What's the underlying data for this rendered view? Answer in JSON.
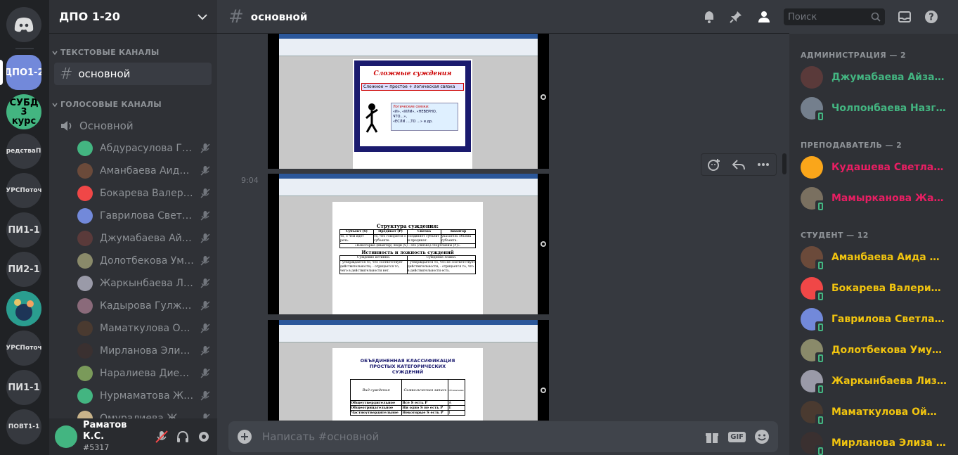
{
  "servers": [
    "ДПО1-2",
    "СУБД 3 курс",
    "СредстваПП",
    "УРСПоточ",
    "ПИ1-1",
    "ПИ2-1",
    "",
    "УРСПоточ",
    "ПИ1-1",
    "ПОВТ1-1"
  ],
  "guild": {
    "name": "ДПО 1-20"
  },
  "categories": {
    "text": "ТЕКСТОВЫЕ КАНАЛЫ",
    "voice": "ГОЛОСОВЫЕ КАНАЛЫ"
  },
  "text_channels": [
    {
      "name": "основной"
    }
  ],
  "voice_channel": {
    "name": "Основной"
  },
  "voice_users": [
    {
      "name": "Абдурасулова Гул...",
      "color": "#43b581"
    },
    {
      "name": "Аманбаева Аида ...",
      "color": "#6b4a3a"
    },
    {
      "name": "Бокарева Валерия ...",
      "color": "#f04747"
    },
    {
      "name": "Гаврилова Светла...",
      "color": "#7289da"
    },
    {
      "name": "Джумабаева Айза...",
      "color": "#5a3a3a"
    },
    {
      "name": "Долотбекова Умут...",
      "color": "#8a8a6a"
    },
    {
      "name": "Жаркынбаева Лиз...",
      "color": "#9a9aa8"
    },
    {
      "name": "Кадырова Гулжана...",
      "color": "#8a6a7a"
    },
    {
      "name": "Маматкулова Ой...",
      "color": "#4a3a30"
    },
    {
      "name": "Мирланова Элиза ...",
      "color": "#3a3030"
    },
    {
      "name": "Наралиева Диеза ...",
      "color": "#7a9a5a"
    },
    {
      "name": "Нурмаматова Жы...",
      "color": "#43b581"
    },
    {
      "name": "Омуралиева Жыл...",
      "color": "#c9b38a"
    }
  ],
  "user": {
    "name": "Раматов К.С.",
    "tag": "#5317"
  },
  "chat": {
    "channel": "основной",
    "search_placeholder": "Поиск",
    "composer_placeholder": "Написать #основной",
    "gif_label": "GIF",
    "timestamp": "9:04"
  },
  "slides": [
    {
      "title": "Сложные суждения",
      "formula": "Сложное = простое + логическая связка",
      "box_title": "Логические связки:",
      "box_lines": [
        "«И», «ИЛИ», «НЕВЕРНО,",
        "ЧТО…»,",
        "«ЕСЛИ …,ТО …» и др."
      ]
    },
    {
      "title": "Структура суждения:",
      "cols": [
        "Субъект (S)",
        "Предикат (P)",
        "Связка",
        "Квантор"
      ],
      "row": [
        "то, о чём идёт речь.",
        "то, что говорится о субъекте.",
        "соединяет субъект и предикат.",
        "указатель объёма субъекта."
      ],
      "example": "«Некоторые (квантор) люди (S) - это (связка) спортсмены (P)».",
      "title2": "Истинность и ложность суждений",
      "cols2": [
        "Суждение истинно:",
        "Суждение ложно:"
      ],
      "cells2": [
        "- утверждается то, что соответствует действительности; - отрицается то, чего в действительности нет.",
        "- утверждается то, что не соответствует действительности; - отрицается то, что в действительности есть."
      ]
    },
    {
      "title": "ОБЪЕДИНЕННАЯ КЛАССИФИКАЦИЯ ПРОСТЫХ КАТЕГОРИЧЕСКИХ СУЖДЕНИЙ",
      "cols": [
        "Вид суждения",
        "Символическая запись",
        "Обозначение"
      ],
      "rows": [
        [
          "Общеутвердительное",
          "Все S есть P",
          "A"
        ],
        [
          "Общеотрицательное",
          "Ни одно S не есть P",
          "E"
        ],
        [
          "Частноутвердительное",
          "Некоторые S есть P",
          "I"
        ]
      ]
    }
  ],
  "members": {
    "groups": [
      {
        "title": "АДМИНИСТРАЦИЯ — 2",
        "color": "#43b581",
        "people": [
          {
            "name": "Джумабаева Айзада ...",
            "av": "#5a3a3a",
            "phone": false
          },
          {
            "name": "Чолпонбаева Назгул...",
            "av": "#747f8d",
            "phone": true
          }
        ]
      },
      {
        "title": "ПРЕПОДАВАТЕЛЬ — 2",
        "color": "#e91e63",
        "people": [
          {
            "name": "Кудашева Светлана ...",
            "av": "#faa61a",
            "phone": false
          },
          {
            "name": "Мамырканова Жарк...",
            "av": "#7a7060",
            "phone": true
          }
        ]
      },
      {
        "title": "СТУДЕНТ — 12",
        "color": "#f1c40f",
        "people": [
          {
            "name": "Аманбаева Аида Жу...",
            "av": "#6b4a3a",
            "phone": true
          },
          {
            "name": "Бокарева Валерия Иг...",
            "av": "#f04747",
            "phone": true
          },
          {
            "name": "Гаврилова Светлана ...",
            "av": "#7289da",
            "phone": true
          },
          {
            "name": "Долотбекова Умут А...",
            "av": "#8a8a6a",
            "phone": true
          },
          {
            "name": "Жаркынбаева Лиза И...",
            "av": "#9a9aa8",
            "phone": true
          },
          {
            "name": "Маматкулова Ойша ...",
            "av": "#4a3a30",
            "phone": true
          },
          {
            "name": "Мирланова Элиза М...",
            "av": "#3a3030",
            "phone": true
          }
        ]
      }
    ]
  }
}
